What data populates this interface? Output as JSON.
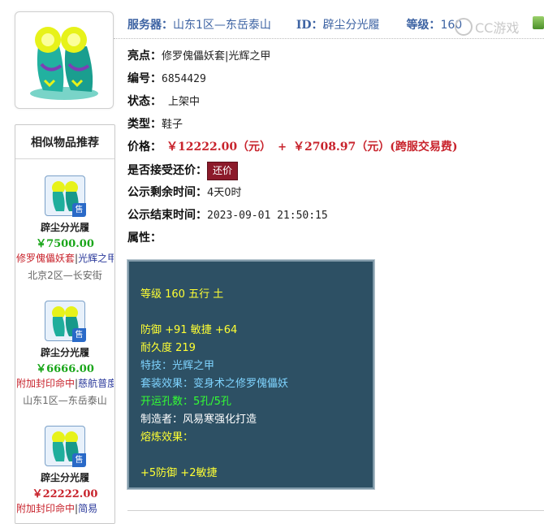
{
  "header": {
    "server_label": "服务器：",
    "server_value": "山东1区—东岳泰山",
    "id_label": "ID：",
    "id_value": "辟尘分光履",
    "level_label": "等级：",
    "level_value": "160",
    "watermark": "CC游戏"
  },
  "details": {
    "highlight_label": "亮点：",
    "highlight_1": "修罗傀儡妖套",
    "highlight_sep": "|",
    "highlight_2": "光辉之甲",
    "number_label": "编号：",
    "number_value": "6854429",
    "status_label": "状态：",
    "status_value": "上架中",
    "type_label": "类型：",
    "type_value": "鞋子",
    "price_label": "价格：",
    "price_value": "￥12222.00（元）",
    "price_plus": "+",
    "fee_value": "￥2708.97（元）(跨服交易费)",
    "counter_label": "是否接受还价：",
    "counter_button": "还价",
    "remaining_label": "公示剩余时间：",
    "remaining_value": "4天0时",
    "end_label": "公示结束时间：",
    "end_value": "2023-09-01 21:50:15",
    "attr_label": "属性："
  },
  "attributes": {
    "level_line": "等级 160 五行 土",
    "stats_line": "防御 +91 敏捷 +64",
    "durability_line": "耐久度 219",
    "skill_line": "特技：光辉之甲",
    "set_line": "套装效果：变身术之修罗傀儡妖",
    "holes_line": "开运孔数：5孔/5孔",
    "maker_line": "制造者：风易寒强化打造",
    "refine_label": "熔炼效果：",
    "refine_line": "+5防御 +2敏捷"
  },
  "sidebar": {
    "title": "相似物品推荐",
    "sale_tag": "售",
    "items": [
      {
        "name": "辟尘分光履",
        "price": "￥7500.00",
        "price_color": "#1aa61a",
        "tag1": "修罗傀儡妖套",
        "tag_sep": "|",
        "tag2": "光辉之甲",
        "server": "北京2区—长安街"
      },
      {
        "name": "辟尘分光履",
        "price": "￥6666.00",
        "price_color": "#1aa61a",
        "tag1": "附加封印命中",
        "tag_sep": "|",
        "tag2": "慈航普度",
        "server": "山东1区—东岳泰山"
      },
      {
        "name": "辟尘分光履",
        "price": "￥22222.00",
        "price_color": "#c8232c",
        "tag1": "附加封印命中",
        "tag_sep": "|",
        "tag2": "简易",
        "server": ""
      }
    ]
  },
  "colors": {
    "header_blue": "#3d63a3",
    "price_red": "#c8232c",
    "button_bg": "#8c1a2a",
    "panel_bg": "#2d5064"
  }
}
